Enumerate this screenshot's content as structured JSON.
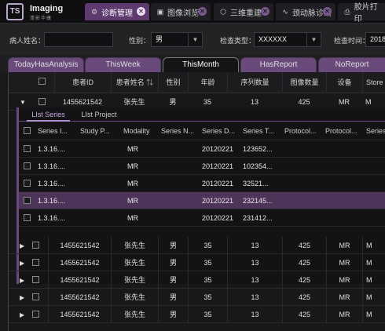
{
  "app": {
    "brand": "Imaging",
    "brand_sub": "清影华康",
    "logo_text": "TS"
  },
  "tabs": [
    {
      "label": "诊断管理",
      "icon": "settings-icon",
      "active": true
    },
    {
      "label": "图像浏览",
      "icon": "image-icon",
      "active": false
    },
    {
      "label": "三维重建",
      "icon": "cube-icon",
      "active": false
    },
    {
      "label": "颈动脉诊断",
      "icon": "pulse-icon",
      "active": false
    },
    {
      "label": "胶片打印",
      "icon": "printer-icon",
      "active": false
    }
  ],
  "search": {
    "name_label": "病人姓名：",
    "name_value": "",
    "gender_label": "性别：",
    "gender_value": "男",
    "exam_type_label": "检查类型：",
    "exam_type_value": "XXXXXX",
    "exam_time_label": "检查时间：",
    "exam_time_value": "2018"
  },
  "view_tabs": [
    "TodayHasAnalysis",
    "ThisWeek",
    "ThisMonth",
    "HasReport",
    "NoReport"
  ],
  "grid": {
    "columns": [
      "患者ID",
      "患者姓名",
      "性别",
      "年龄",
      "序列数量",
      "图像数量",
      "设备",
      "Store"
    ],
    "rows": [
      {
        "id": "1455621542",
        "name": "张先生",
        "gender": "男",
        "age": "35",
        "series": "13",
        "images": "425",
        "device": "MR",
        "store": "M"
      },
      {
        "id": "1455621542",
        "name": "张先生",
        "gender": "男",
        "age": "35",
        "series": "13",
        "images": "425",
        "device": "MR",
        "store": "M"
      },
      {
        "id": "1455621542",
        "name": "张先生",
        "gender": "男",
        "age": "35",
        "series": "13",
        "images": "425",
        "device": "MR",
        "store": "M"
      },
      {
        "id": "1455621542",
        "name": "张先生",
        "gender": "男",
        "age": "35",
        "series": "13",
        "images": "425",
        "device": "MR",
        "store": "M"
      },
      {
        "id": "1455621542",
        "name": "张先生",
        "gender": "男",
        "age": "35",
        "series": "13",
        "images": "425",
        "device": "MR",
        "store": "M"
      },
      {
        "id": "1455621542",
        "name": "张先生",
        "gender": "男",
        "age": "35",
        "series": "13",
        "images": "425",
        "device": "MR",
        "store": "M"
      }
    ]
  },
  "detail": {
    "tabs": [
      "LIst Series",
      "LIst Project"
    ],
    "columns": [
      "Series I...",
      "Study P...",
      "Modality",
      "Series N...",
      "Series D...",
      "Series T...",
      "Protocol...",
      "Protocol...",
      "Series I"
    ],
    "rows": [
      {
        "series_id": "1.3.16....",
        "modality": "MR",
        "date": "20120221",
        "time": "123652..."
      },
      {
        "series_id": "1.3.16....",
        "modality": "MR",
        "date": "20120221",
        "time": "102354..."
      },
      {
        "series_id": "1.3.16....",
        "modality": "MR",
        "date": "20120221",
        "time": "32521..."
      },
      {
        "series_id": "1.3.16....",
        "modality": "MR",
        "date": "20120221",
        "time": "232145..."
      },
      {
        "series_id": "1.3.16....",
        "modality": "MR",
        "date": "20120221",
        "time": "231412..."
      }
    ]
  },
  "colors": {
    "accent": "#5e3a6e",
    "tab_purple": "#6a4a7b",
    "selected_row": "#4d3459"
  }
}
